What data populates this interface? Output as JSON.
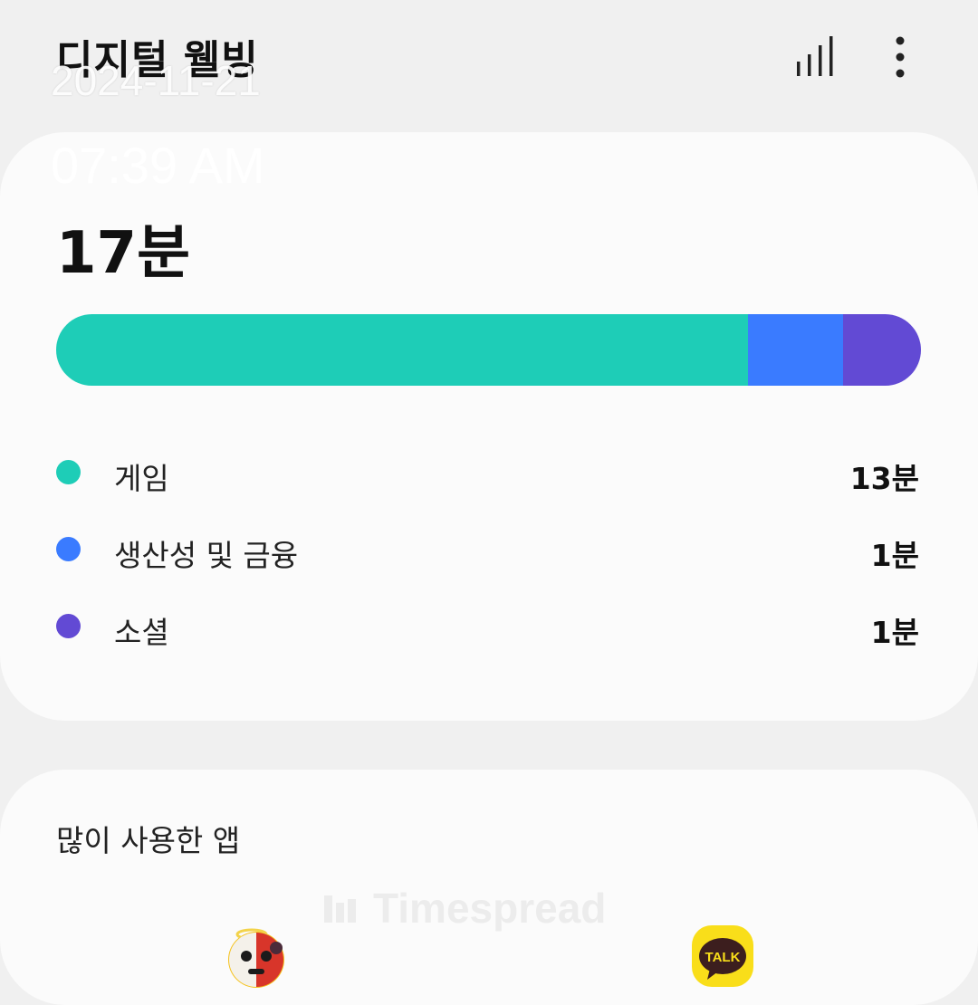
{
  "header": {
    "title": "디지털 웰빙",
    "chart_icon": "bar-chart-icon",
    "more_icon": "more-vertical-icon"
  },
  "overlay": {
    "date": "2024-11-21",
    "time": "07:39 AM"
  },
  "summary": {
    "total": "17분",
    "categories": [
      {
        "label": "게임",
        "value": "13분",
        "minutes": 13,
        "color": "#1ecdb7"
      },
      {
        "label": "생산성 및 금융",
        "value": "1분",
        "minutes": 1,
        "color": "#3a7bff"
      },
      {
        "label": "소셜",
        "value": "1분",
        "minutes": 1,
        "color": "#624ad4"
      }
    ],
    "bar_fractions": [
      0.8,
      0.11,
      0.09
    ]
  },
  "apps": {
    "heading": "많이 사용한 앱",
    "watermark": "Timespread",
    "items": [
      {
        "icon": "game-character-app-icon"
      },
      {
        "icon": "kakaotalk-app-icon",
        "badge_text": "TALK"
      }
    ]
  },
  "colors": {
    "background": "#f0f0f0",
    "card": "#fbfbfb",
    "game": "#1ecdb7",
    "productivity": "#3a7bff",
    "social": "#624ad4"
  }
}
